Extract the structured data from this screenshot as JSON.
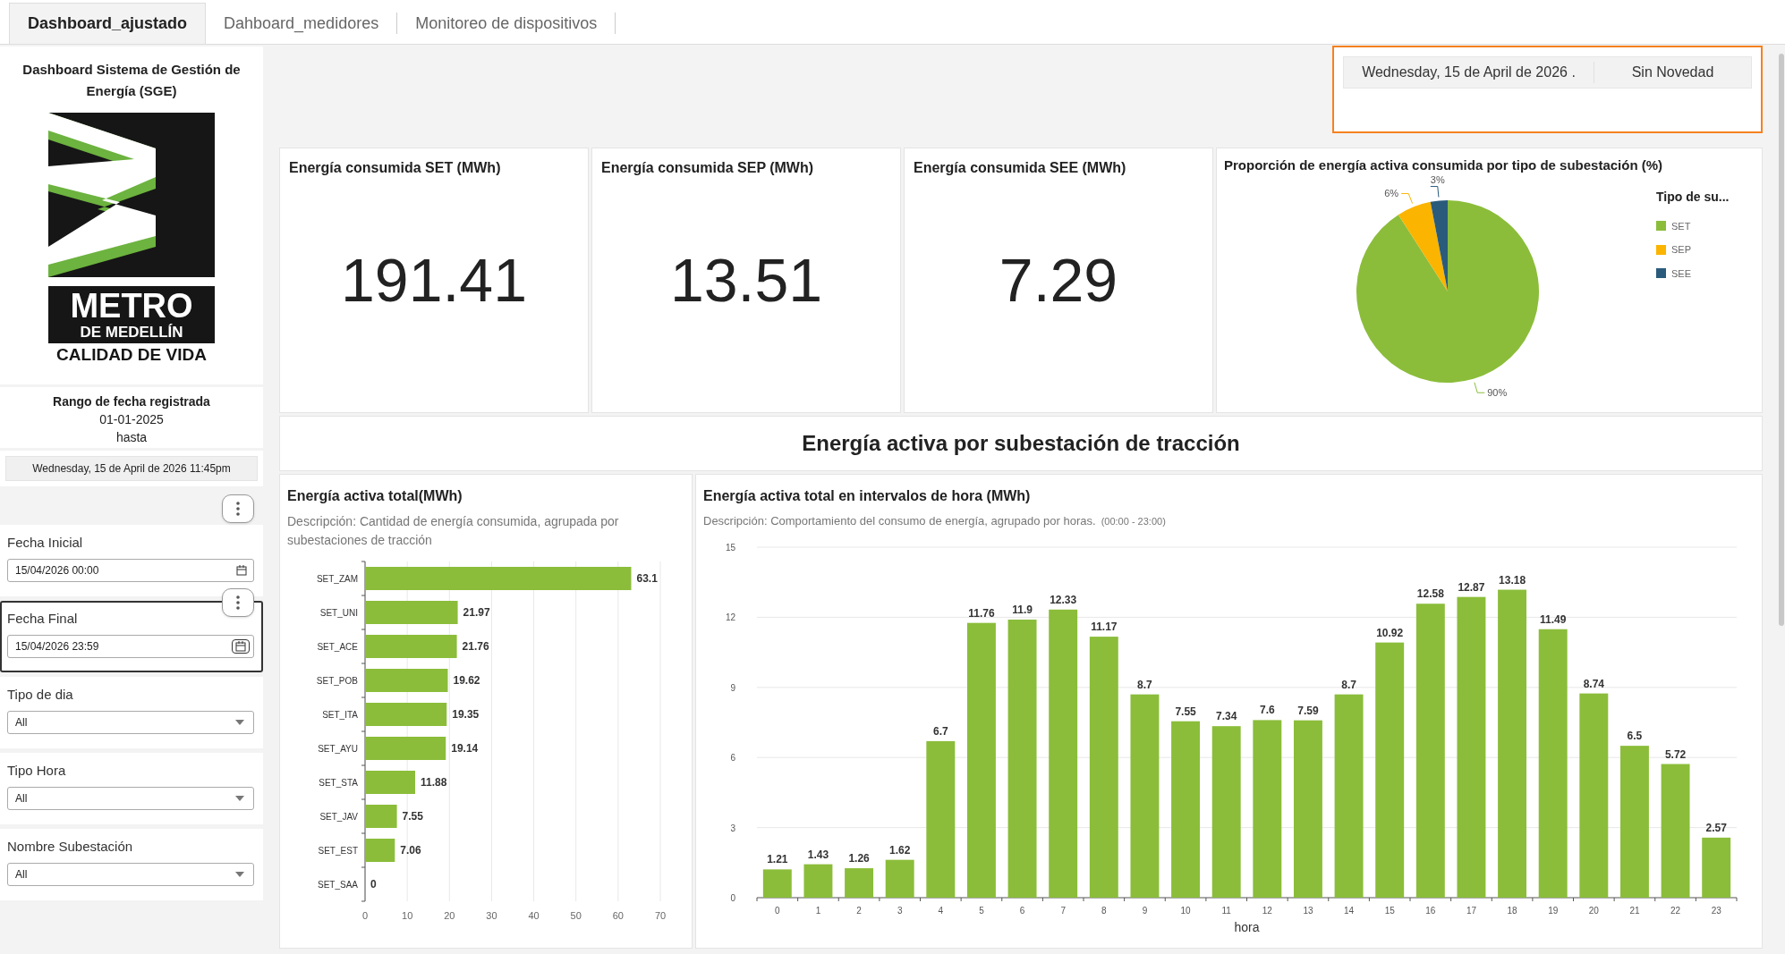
{
  "tabs": [
    {
      "label": "Dashboard_ajustado",
      "selected": true
    },
    {
      "label": "Dahboard_medidores",
      "selected": false
    },
    {
      "label": "Monitoreo de dispositivos",
      "selected": false
    }
  ],
  "sidebar": {
    "title": "Dashboard Sistema de Gestión de Energía (SGE)",
    "logo": {
      "line_1": "METRO",
      "line_2": "DE MEDELLÍN",
      "line_3": "CALIDAD DE VIDA"
    },
    "date_range": {
      "title": "Rango de fecha registrada",
      "start": "01-01-2025",
      "separator": "hasta",
      "end": "Wednesday, 15 de April de 2026 11:45pm"
    },
    "filters": [
      {
        "kind": "date",
        "label": "Fecha Inicial",
        "value": "15/04/2026 00:00",
        "focused": false
      },
      {
        "kind": "date",
        "label": "Fecha Final",
        "value": "15/04/2026 23:59",
        "focused": true
      },
      {
        "kind": "dropdown",
        "label": "Tipo de dia",
        "value": "All",
        "focused": false
      },
      {
        "kind": "dropdown",
        "label": "Tipo Hora",
        "value": "All",
        "focused": false
      },
      {
        "kind": "dropdown",
        "label": "Nombre Subestación",
        "value": "All",
        "focused": false
      }
    ]
  },
  "header_box": {
    "date": "Wednesday, 15 de April de 2026 .",
    "status": "Sin Novedad"
  },
  "kpis": [
    {
      "title": "Energía consumida SET (MWh)",
      "value": "191.41"
    },
    {
      "title": "Energía consumida SEP (MWh)",
      "value": "13.51"
    },
    {
      "title": "Energía consumida SEE (MWh)",
      "value": "7.29"
    }
  ],
  "pie": {
    "title": "Proporción de energía activa consumida por tipo de subestación (%)",
    "legend_title": "Tipo de su...",
    "chart_data": {
      "type": "pie",
      "categories": [
        "SET",
        "SEP",
        "SEE"
      ],
      "values": [
        90,
        6,
        3
      ],
      "colors": [
        "#8bbd3a",
        "#fbb400",
        "#2a5b7b"
      ],
      "value_labels": [
        "90%",
        "6%",
        "3%"
      ]
    }
  },
  "section_title": "Energía activa por subestación de tracción",
  "station_chart": {
    "title": "Energía activa total(MWh)",
    "description": "Descripción: Cantidad de energía consumida, agrupada por subestaciones de tracción",
    "chart_data": {
      "type": "bar",
      "orientation": "horizontal",
      "categories": [
        "SET_ZAM",
        "SET_UNI",
        "SET_ACE",
        "SET_POB",
        "SET_ITA",
        "SET_AYU",
        "SET_STA",
        "SET_JAV",
        "SET_EST",
        "SET_SAA"
      ],
      "values": [
        63.1,
        21.97,
        21.76,
        19.62,
        19.35,
        19.14,
        11.88,
        7.55,
        7.06,
        0
      ],
      "xlim": [
        0,
        70
      ],
      "xticks": [
        0,
        10,
        20,
        30,
        40,
        50,
        60,
        70
      ],
      "grid": true,
      "data_labels": true
    }
  },
  "hour_chart": {
    "title": "Energía activa total en intervalos de hora  (MWh)",
    "description": "Descripción: Comportamiento del consumo de energía, agrupado por horas.",
    "range_note": "(00:00 - 23:00)",
    "chart_data": {
      "type": "bar",
      "xlabel": "hora",
      "categories": [
        "0",
        "1",
        "2",
        "3",
        "4",
        "5",
        "6",
        "7",
        "8",
        "9",
        "10",
        "11",
        "12",
        "13",
        "14",
        "15",
        "16",
        "17",
        "18",
        "19",
        "20",
        "21",
        "22",
        "23"
      ],
      "values": [
        1.21,
        1.43,
        1.26,
        1.62,
        6.7,
        11.76,
        11.9,
        12.33,
        11.17,
        8.7,
        7.55,
        7.34,
        7.6,
        7.59,
        8.7,
        10.92,
        12.58,
        12.87,
        13.18,
        11.49,
        8.74,
        6.5,
        5.72,
        2.57
      ],
      "ylim": [
        0,
        15
      ],
      "yticks": [
        0,
        3,
        6,
        9,
        12,
        15
      ],
      "grid": true,
      "data_labels": true
    }
  }
}
